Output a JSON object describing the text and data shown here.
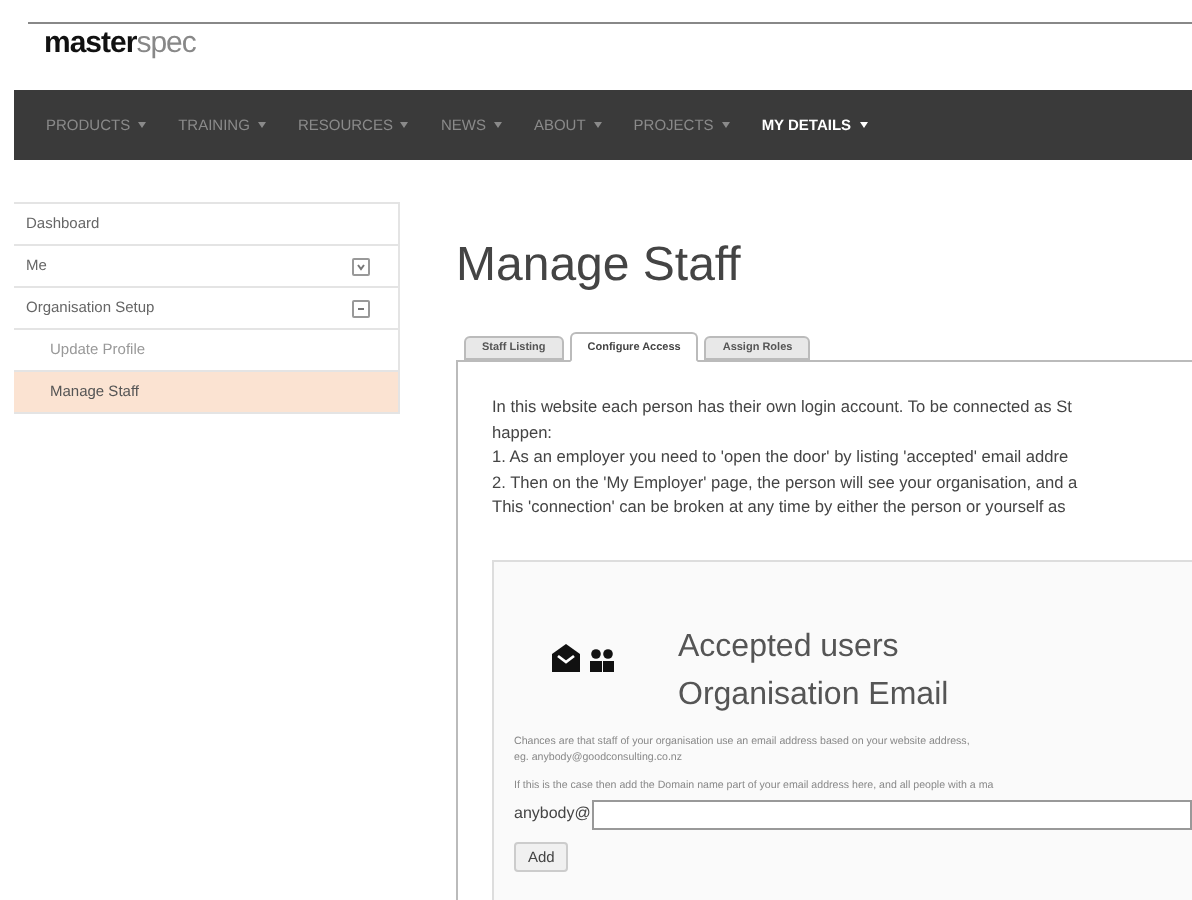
{
  "logo": {
    "part_1": "master",
    "part_2": "spec"
  },
  "nav": [
    {
      "label": "PRODUCTS",
      "selected": false
    },
    {
      "label": "TRAINING",
      "selected": false
    },
    {
      "label": "RESOURCES",
      "selected": false
    },
    {
      "label": "NEWS",
      "selected": false
    },
    {
      "label": "ABOUT",
      "selected": false
    },
    {
      "label": "PROJECTS",
      "selected": false
    },
    {
      "label": "MY DETAILS",
      "selected": true
    }
  ],
  "sidebar": {
    "items": [
      {
        "label": "Dashboard",
        "selected": false
      },
      {
        "label": "Me",
        "selected": false,
        "expanded": false
      },
      {
        "label": "Organisation Setup",
        "selected": false,
        "expanded": true,
        "children": [
          {
            "label": "Update Profile",
            "selected": false
          },
          {
            "label": "Manage Staff",
            "selected": true
          }
        ]
      }
    ]
  },
  "page_title": "Manage Staff",
  "tabs": [
    {
      "label": "Staff Listing",
      "selected": false
    },
    {
      "label": "Configure Access",
      "selected": true
    },
    {
      "label": "Assign Roles",
      "selected": false
    }
  ],
  "intro_lines": [
    "In this website each person has their own login account. To be connected as St",
    "happen:",
    "1. As an employer you need to 'open the door' by listing 'accepted' email addre",
    "2. Then on the 'My Employer' page, the person will see your organisation, and a",
    "This 'connection' can be broken at any time by either the person or yourself as"
  ],
  "card": {
    "title_1": "Accepted users",
    "title_2": "Organisation Email",
    "note_lines": [
      "Chances are that staff of your organisation use an email address based on your website address,",
      "eg. anybody@goodconsulting.co.nz"
    ],
    "hint": "If this is the case then add the Domain name part of your email address here, and all people with a ma",
    "field_label": "anybody@",
    "add_button": "Add"
  }
}
